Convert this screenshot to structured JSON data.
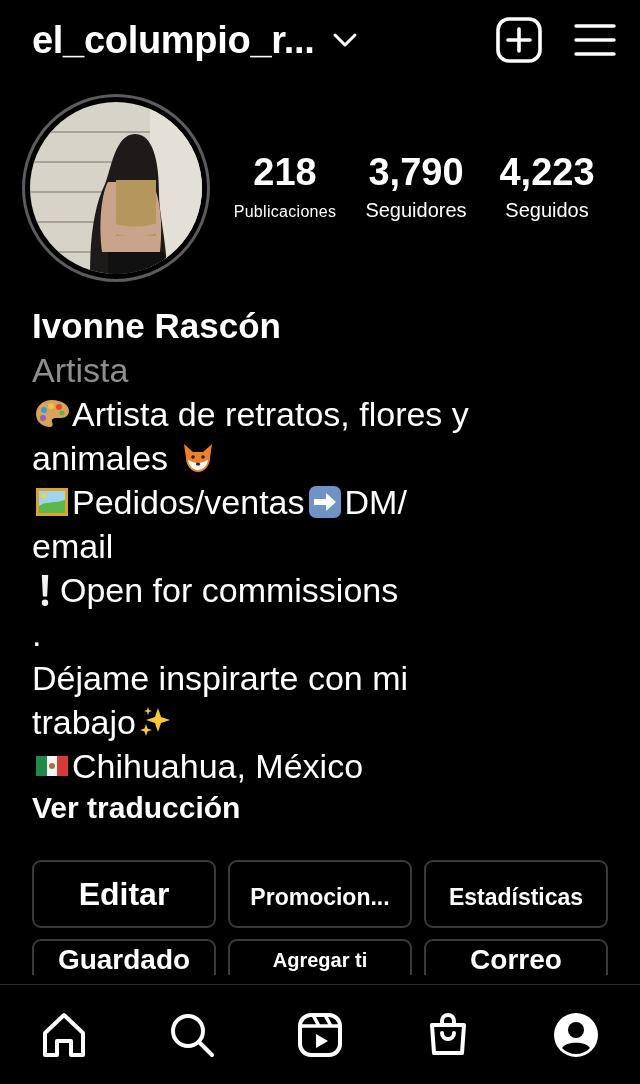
{
  "top_bar": {
    "username": "el_columpio_r..."
  },
  "profile": {
    "avatar": {
      "kind": "picture"
    },
    "stats": [
      {
        "value": "218",
        "label": "Publicaciones"
      },
      {
        "value": "3,790",
        "label": "Seguidores"
      },
      {
        "value": "4,223",
        "label": "Seguidos"
      }
    ],
    "name": "Ivonne Rascón",
    "category": "Artista",
    "bio_lines": [
      [
        {
          "kind": "palette"
        },
        {
          "kind": "text",
          "text": "Artista de retratos, flores y"
        }
      ],
      [
        {
          "kind": "text",
          "text": "animales"
        },
        {
          "kind": "fox"
        }
      ],
      [
        {
          "kind": "frame"
        },
        {
          "kind": "text",
          "text": "Pedidos/ventas"
        },
        {
          "kind": "arrow"
        },
        {
          "kind": "text",
          "text": "DM/"
        }
      ],
      [
        {
          "kind": "text",
          "text": "email"
        }
      ],
      [
        {
          "kind": "exclamation"
        },
        {
          "kind": "text",
          "text": "Open for commissions"
        }
      ],
      [
        {
          "kind": "text",
          "text": "."
        }
      ],
      [
        {
          "kind": "text",
          "text": "Déjame inspirarte con mi"
        }
      ],
      [
        {
          "kind": "text",
          "text": "trabajo"
        },
        {
          "kind": "sparkles"
        }
      ],
      [
        {
          "kind": "flag"
        },
        {
          "kind": "text",
          "text": "Chihuahua, México"
        }
      ]
    ],
    "translate_link": "Ver traducción"
  },
  "buttons": [
    {
      "label": "Editar",
      "kind": "large"
    },
    {
      "label": "Promocion...",
      "kind": "small"
    },
    {
      "label": "Estadísticas",
      "kind": "small"
    },
    {
      "label": "Guardado",
      "kind": "large"
    },
    {
      "label": "Agregar ti",
      "kind": "small"
    },
    {
      "label": "Correo",
      "kind": "large"
    }
  ],
  "nav": [
    {
      "kind": "home",
      "selected": false
    },
    {
      "kind": "search",
      "selected": false
    },
    {
      "kind": "reels",
      "selected": false
    },
    {
      "kind": "shop",
      "selected": false
    },
    {
      "kind": "profile",
      "selected": true
    }
  ]
}
